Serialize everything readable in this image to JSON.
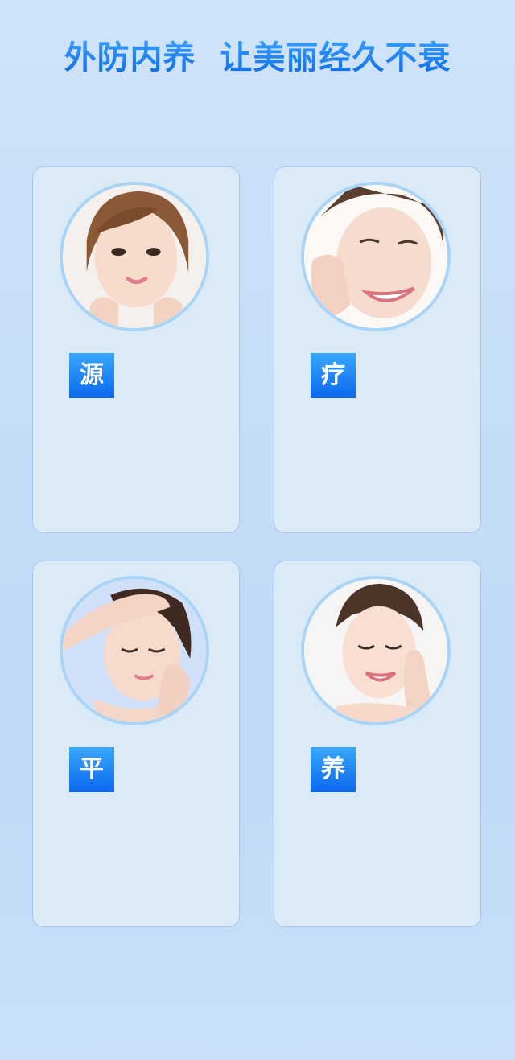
{
  "header": {
    "title": "外防内养  让美丽经久不衰"
  },
  "cards": [
    {
      "tag": "源",
      "portrait_icon": "woman-face-photo",
      "pose": "hands-on-chin"
    },
    {
      "tag": "疗",
      "portrait_icon": "woman-face-photo",
      "pose": "hand-on-cheek-smiling"
    },
    {
      "tag": "平",
      "portrait_icon": "woman-face-photo",
      "pose": "hand-on-forehead-eyes-closed"
    },
    {
      "tag": "养",
      "portrait_icon": "woman-face-photo",
      "pose": "finger-on-cheek-smiling"
    }
  ],
  "colors": {
    "background": "#c4dcf7",
    "card": "#dbeaf7",
    "card_border": "#a9c9ea",
    "accent_top": "#39a7ff",
    "accent_bottom": "#0a68ee",
    "title_blue": "#0a66e8",
    "ring": "#a9d4f5"
  }
}
